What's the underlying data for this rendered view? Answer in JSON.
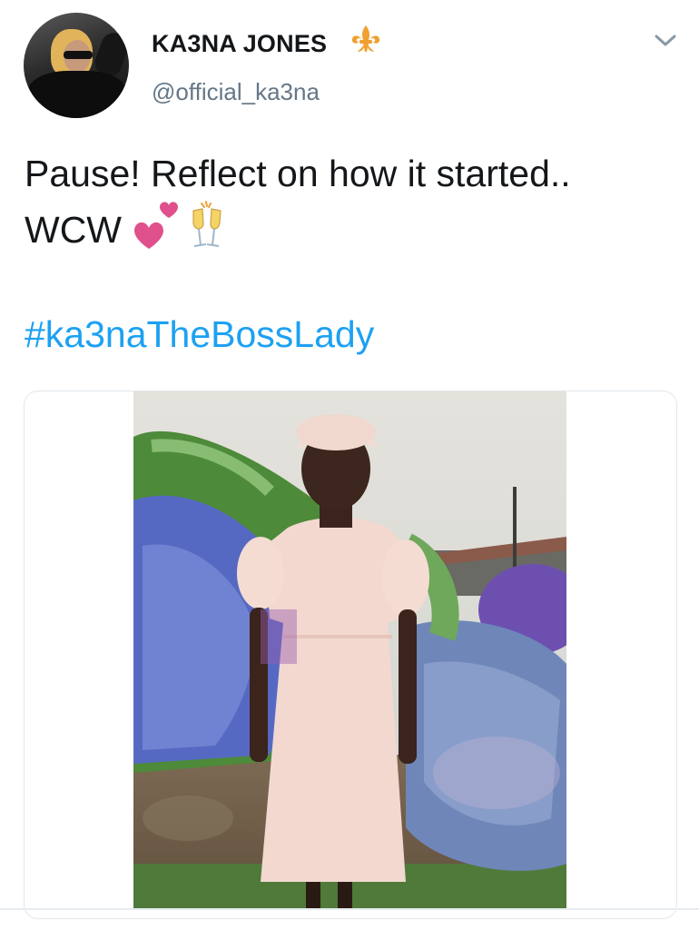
{
  "tweet": {
    "display_name": "KA3NA JONES",
    "badge_icon": "fleur-de-lis-icon",
    "handle": "@official_ka3na",
    "menu_icon": "chevron-down-icon",
    "text_line1": "Pause! Reflect on how it started..",
    "text_line2": "WCW",
    "emojis": [
      "two-hearts-icon",
      "clinking-glasses-icon"
    ],
    "hashtag": "#ka3naTheBossLady"
  },
  "media": {
    "type": "photo",
    "content": "vintage-photo-girl-in-white-dress"
  },
  "colors": {
    "text": "#14171a",
    "secondary": "#657786",
    "link": "#1da1f2",
    "badge": "#f0a030",
    "heart": "#e0508c",
    "border": "#e1e8ed"
  }
}
